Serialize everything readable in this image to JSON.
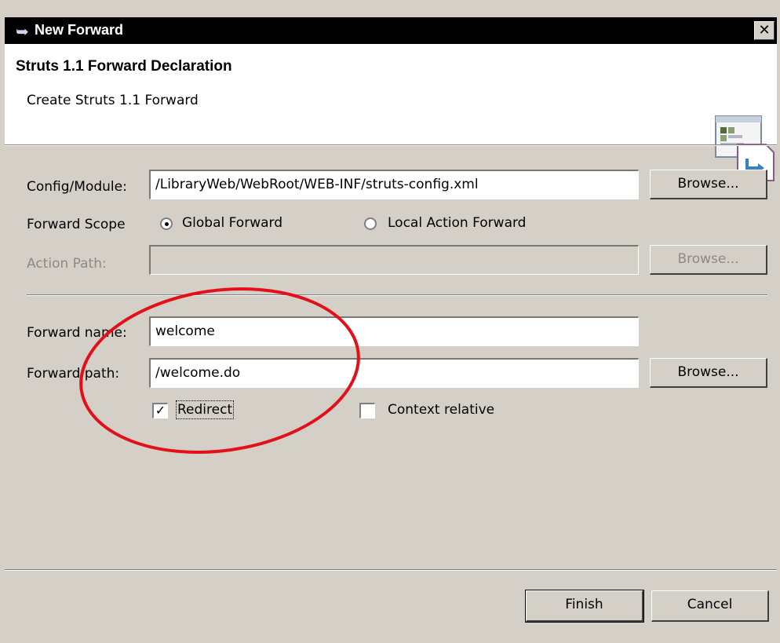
{
  "window": {
    "title": "New Forward",
    "close_glyph": "✕"
  },
  "banner": {
    "title": "Struts 1.1 Forward Declaration",
    "description": "Create Struts 1.1 Forward",
    "icon": "forward-wizard-icon"
  },
  "form": {
    "config_label": "Config/Module:",
    "config_value": "/LibraryWeb/WebRoot/WEB-INF/struts-config.xml",
    "config_browse": "Browse...",
    "scope_label": "Forward Scope",
    "scope_options": [
      {
        "label": "Global Forward",
        "selected": true
      },
      {
        "label": "Local Action Forward",
        "selected": false
      }
    ],
    "action_path_label": "Action Path:",
    "action_path_value": "",
    "action_path_browse": "Browse...",
    "forward_name_label": "Forward name:",
    "forward_name_value": "welcome",
    "forward_path_label": "Forward path:",
    "forward_path_value": "/welcome.do",
    "forward_path_browse": "Browse...",
    "redirect_label": "Redirect",
    "redirect_checked": true,
    "context_relative_label": "Context relative",
    "context_relative_checked": false
  },
  "footer": {
    "finish_label": "Finish",
    "cancel_label": "Cancel"
  },
  "colors": {
    "titlebar": "#000000",
    "dialog": "#d4d0c8",
    "annotation": "#e3101a"
  }
}
